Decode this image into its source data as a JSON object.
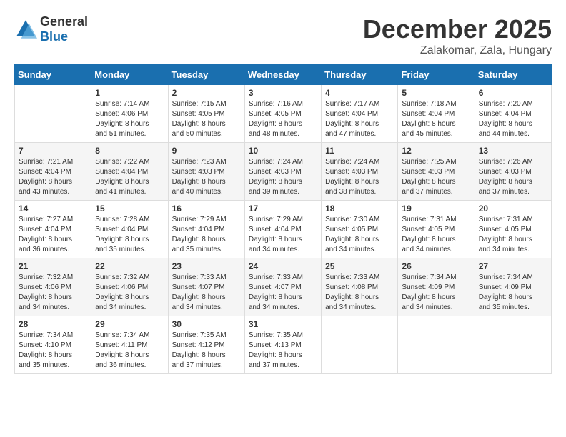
{
  "header": {
    "logo_general": "General",
    "logo_blue": "Blue",
    "month": "December 2025",
    "location": "Zalakomar, Zala, Hungary"
  },
  "weekdays": [
    "Sunday",
    "Monday",
    "Tuesday",
    "Wednesday",
    "Thursday",
    "Friday",
    "Saturday"
  ],
  "weeks": [
    [
      {
        "day": "",
        "info": ""
      },
      {
        "day": "1",
        "info": "Sunrise: 7:14 AM\nSunset: 4:06 PM\nDaylight: 8 hours\nand 51 minutes."
      },
      {
        "day": "2",
        "info": "Sunrise: 7:15 AM\nSunset: 4:05 PM\nDaylight: 8 hours\nand 50 minutes."
      },
      {
        "day": "3",
        "info": "Sunrise: 7:16 AM\nSunset: 4:05 PM\nDaylight: 8 hours\nand 48 minutes."
      },
      {
        "day": "4",
        "info": "Sunrise: 7:17 AM\nSunset: 4:04 PM\nDaylight: 8 hours\nand 47 minutes."
      },
      {
        "day": "5",
        "info": "Sunrise: 7:18 AM\nSunset: 4:04 PM\nDaylight: 8 hours\nand 45 minutes."
      },
      {
        "day": "6",
        "info": "Sunrise: 7:20 AM\nSunset: 4:04 PM\nDaylight: 8 hours\nand 44 minutes."
      }
    ],
    [
      {
        "day": "7",
        "info": "Sunrise: 7:21 AM\nSunset: 4:04 PM\nDaylight: 8 hours\nand 43 minutes."
      },
      {
        "day": "8",
        "info": "Sunrise: 7:22 AM\nSunset: 4:04 PM\nDaylight: 8 hours\nand 41 minutes."
      },
      {
        "day": "9",
        "info": "Sunrise: 7:23 AM\nSunset: 4:03 PM\nDaylight: 8 hours\nand 40 minutes."
      },
      {
        "day": "10",
        "info": "Sunrise: 7:24 AM\nSunset: 4:03 PM\nDaylight: 8 hours\nand 39 minutes."
      },
      {
        "day": "11",
        "info": "Sunrise: 7:24 AM\nSunset: 4:03 PM\nDaylight: 8 hours\nand 38 minutes."
      },
      {
        "day": "12",
        "info": "Sunrise: 7:25 AM\nSunset: 4:03 PM\nDaylight: 8 hours\nand 37 minutes."
      },
      {
        "day": "13",
        "info": "Sunrise: 7:26 AM\nSunset: 4:03 PM\nDaylight: 8 hours\nand 37 minutes."
      }
    ],
    [
      {
        "day": "14",
        "info": "Sunrise: 7:27 AM\nSunset: 4:04 PM\nDaylight: 8 hours\nand 36 minutes."
      },
      {
        "day": "15",
        "info": "Sunrise: 7:28 AM\nSunset: 4:04 PM\nDaylight: 8 hours\nand 35 minutes."
      },
      {
        "day": "16",
        "info": "Sunrise: 7:29 AM\nSunset: 4:04 PM\nDaylight: 8 hours\nand 35 minutes."
      },
      {
        "day": "17",
        "info": "Sunrise: 7:29 AM\nSunset: 4:04 PM\nDaylight: 8 hours\nand 34 minutes."
      },
      {
        "day": "18",
        "info": "Sunrise: 7:30 AM\nSunset: 4:05 PM\nDaylight: 8 hours\nand 34 minutes."
      },
      {
        "day": "19",
        "info": "Sunrise: 7:31 AM\nSunset: 4:05 PM\nDaylight: 8 hours\nand 34 minutes."
      },
      {
        "day": "20",
        "info": "Sunrise: 7:31 AM\nSunset: 4:05 PM\nDaylight: 8 hours\nand 34 minutes."
      }
    ],
    [
      {
        "day": "21",
        "info": "Sunrise: 7:32 AM\nSunset: 4:06 PM\nDaylight: 8 hours\nand 34 minutes."
      },
      {
        "day": "22",
        "info": "Sunrise: 7:32 AM\nSunset: 4:06 PM\nDaylight: 8 hours\nand 34 minutes."
      },
      {
        "day": "23",
        "info": "Sunrise: 7:33 AM\nSunset: 4:07 PM\nDaylight: 8 hours\nand 34 minutes."
      },
      {
        "day": "24",
        "info": "Sunrise: 7:33 AM\nSunset: 4:07 PM\nDaylight: 8 hours\nand 34 minutes."
      },
      {
        "day": "25",
        "info": "Sunrise: 7:33 AM\nSunset: 4:08 PM\nDaylight: 8 hours\nand 34 minutes."
      },
      {
        "day": "26",
        "info": "Sunrise: 7:34 AM\nSunset: 4:09 PM\nDaylight: 8 hours\nand 34 minutes."
      },
      {
        "day": "27",
        "info": "Sunrise: 7:34 AM\nSunset: 4:09 PM\nDaylight: 8 hours\nand 35 minutes."
      }
    ],
    [
      {
        "day": "28",
        "info": "Sunrise: 7:34 AM\nSunset: 4:10 PM\nDaylight: 8 hours\nand 35 minutes."
      },
      {
        "day": "29",
        "info": "Sunrise: 7:34 AM\nSunset: 4:11 PM\nDaylight: 8 hours\nand 36 minutes."
      },
      {
        "day": "30",
        "info": "Sunrise: 7:35 AM\nSunset: 4:12 PM\nDaylight: 8 hours\nand 37 minutes."
      },
      {
        "day": "31",
        "info": "Sunrise: 7:35 AM\nSunset: 4:13 PM\nDaylight: 8 hours\nand 37 minutes."
      },
      {
        "day": "",
        "info": ""
      },
      {
        "day": "",
        "info": ""
      },
      {
        "day": "",
        "info": ""
      }
    ]
  ]
}
